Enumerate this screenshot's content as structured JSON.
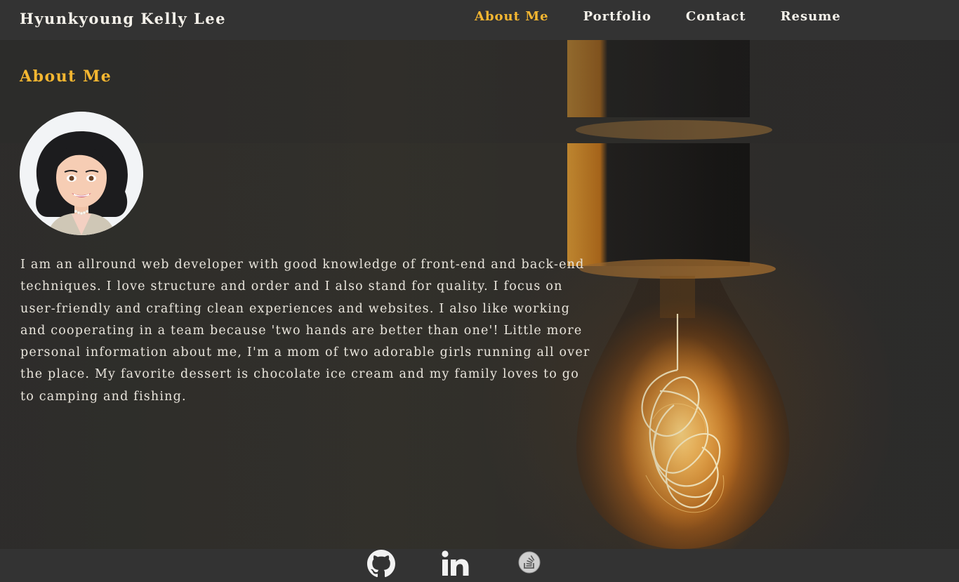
{
  "header": {
    "brand": "Hyunkyoung Kelly Lee",
    "nav": [
      {
        "label": "About Me",
        "active": true
      },
      {
        "label": "Portfolio",
        "active": false
      },
      {
        "label": "Contact",
        "active": false
      },
      {
        "label": "Resume",
        "active": false
      }
    ]
  },
  "main": {
    "section_title": "About Me",
    "avatar_icon": "avatar-cartoon-woman",
    "bio": "I am an allround web developer with good knowledge of front-end and back-end techniques. I love structure and order and I also stand for quality. I focus on user-friendly and crafting clean experiences and websites. I also like working and cooperating in a team because 'two hands are better than one'! Little more personal information about me, I'm a mom of two adorable girls running all over the place. My favorite dessert is chocolate ice cream and my family loves to go to camping and fishing."
  },
  "footer": {
    "links": [
      {
        "icon": "github-icon"
      },
      {
        "icon": "linkedin-icon"
      },
      {
        "icon": "stackoverflow-icon"
      }
    ]
  },
  "colors": {
    "accent": "#f5b731",
    "bar": "#333333",
    "text": "#e9e5dc"
  }
}
